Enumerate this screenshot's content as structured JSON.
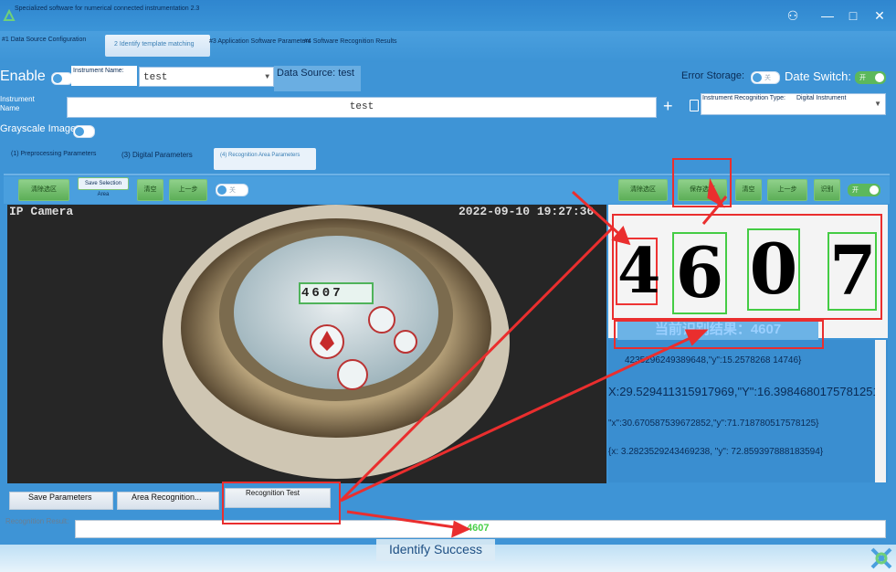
{
  "window": {
    "title": "Specialized software for numerical connected instrumentation 2.3",
    "controls": [
      "shirt-icon",
      "minimize-icon",
      "maximize-icon",
      "close-icon"
    ]
  },
  "tabs": [
    {
      "label": "#1 Data Source Configuration"
    },
    {
      "label": "2 Identify template matching",
      "active": true
    },
    {
      "label": "#3 Application Software Parameters"
    },
    {
      "label": "#4 Software Recognition Results"
    }
  ],
  "row1": {
    "enable_label": "Enable",
    "instrument_name_label": "Instrument Name:",
    "instrument_name_value": "test",
    "data_source_label": "Data Source: test",
    "error_storage_label": "Error Storage:",
    "error_storage_toggle": "关",
    "date_switch_label": "Date Switch:",
    "date_switch_toggle": "开"
  },
  "row2": {
    "instrument_name_label": "Instrument\nName",
    "instrument_name_value": "test",
    "recognition_type_label": "Instrument Recognition Type:",
    "recognition_type_value": "Digital Instrument"
  },
  "row3": {
    "grayscale_label": "Grayscale Image:"
  },
  "subtabs": [
    {
      "label": "(1) Preprocessing Parameters"
    },
    {
      "label": "(3) Digital Parameters"
    },
    {
      "label": "(4) Recognition Area Parameters",
      "active": true
    }
  ],
  "left_toolbar": {
    "buttons": [
      "清除选区",
      "Save Selection Area",
      "清空",
      "上一步"
    ],
    "toggle": "关"
  },
  "right_toolbar": {
    "buttons": [
      "清除选区",
      "保存选区",
      "清空",
      "上一步",
      "识别"
    ],
    "toggle": "开"
  },
  "camera": {
    "overlay_title": "IP Camera",
    "timestamp": "2022-09-10 19:27:36",
    "meter_digits": "4607"
  },
  "digits_preview": {
    "digits": [
      "4",
      "6",
      "0",
      "7"
    ],
    "current_result": "当前识别结果：4607"
  },
  "coord_list": [
    "4235296249389648,\"y\":15.2578268 14746}",
    "X:29.529411315917969,\"Y\":16.3984680175781251",
    "\"x\":30.670587539672852,\"y\":71.718780517578125}",
    "{x: 3.2823529243469238, \"y\": 72.859397888183594}"
  ],
  "bottom_buttons": [
    "Save Parameters",
    "Area Recognition...",
    "Recognition Test"
  ],
  "result": {
    "label": "Recognition Result:",
    "value": "4607"
  },
  "status": "Identify Success",
  "colors": {
    "accent": "#3e94d6",
    "annotation_red": "#ea2e2e",
    "green": "#5cb85c"
  }
}
